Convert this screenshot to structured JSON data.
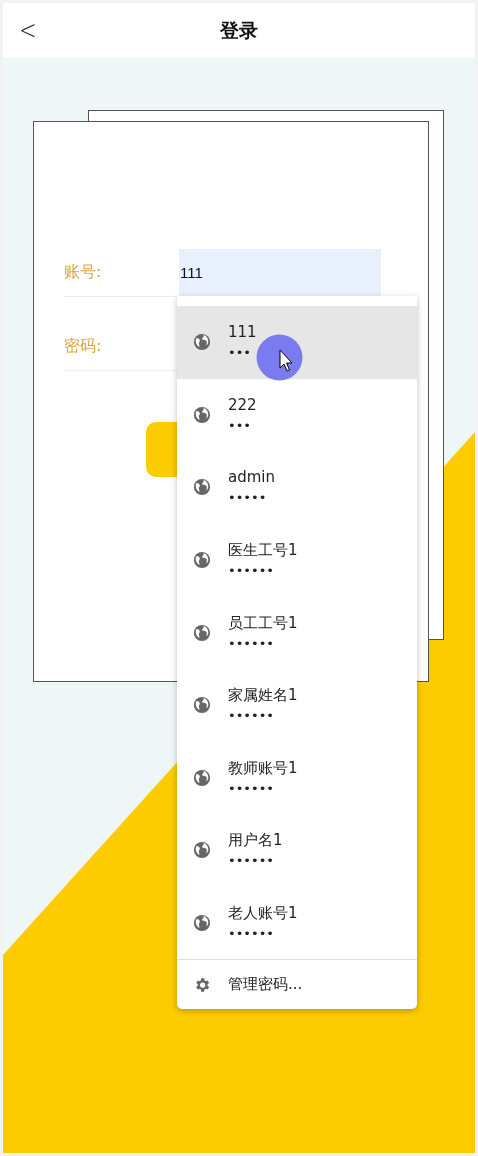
{
  "header": {
    "back": "<",
    "title": "登录"
  },
  "form": {
    "fields": [
      {
        "label": "账号:",
        "value": "111"
      },
      {
        "label": "密码:"
      }
    ]
  },
  "autofill": {
    "suggestions": [
      {
        "username": "111",
        "password": "•••",
        "selected": true
      },
      {
        "username": "222",
        "password": "•••",
        "selected": false
      },
      {
        "username": "admin",
        "password": "•••••",
        "selected": false
      },
      {
        "username": "医生工号1",
        "password": "••••••",
        "selected": false
      },
      {
        "username": "员工工号1",
        "password": "••••••",
        "selected": false
      },
      {
        "username": "家属姓名1",
        "password": "••••••",
        "selected": false
      },
      {
        "username": "教师账号1",
        "password": "••••••",
        "selected": false
      },
      {
        "username": "用户名1",
        "password": "••••••",
        "selected": false
      },
      {
        "username": "老人账号1",
        "password": "••••••",
        "selected": false
      }
    ],
    "footer": "管理密码..."
  }
}
